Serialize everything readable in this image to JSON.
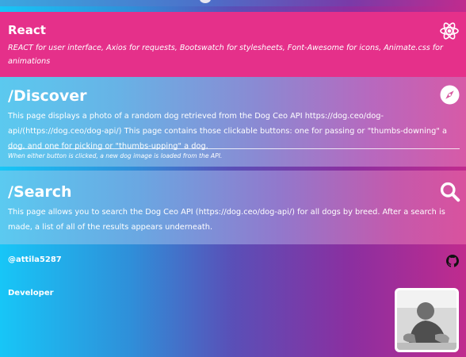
{
  "react": {
    "title": "React",
    "description": "REACT for user interface, Axios for requests, Bootswatch for stylesheets, Font-Awesome for icons, Animate.css for animations",
    "icon": "react-icon"
  },
  "discover": {
    "title": "/Discover",
    "description": "This page displays a photo of a random dog retrieved from the Dog Ceo API https://dog.ceo/dog-api/(https://dog.ceo/dog-api/) This page contains those clickable buttons: one for passing or \"thumbs-downing\" a dog, and one for picking or \"thumbs-upping\" a dog.",
    "note": "When either button is clicked, a new dog image is loaded from the API.",
    "icon": "compass-icon"
  },
  "search": {
    "title": "/Search",
    "description": "This page allows you to search the Dog Ceo API (https://dog.ceo/dog-api/) for all dogs by breed. After a search is made, a list of all of the results appears underneath.",
    "icon": "search-icon"
  },
  "footer": {
    "handle": "@attila5287",
    "role": "Developer",
    "github_icon": "github-icon"
  },
  "colors": {
    "react_card": "#e5308a",
    "accent_pink": "#e62f8b",
    "accent_cyan": "#17c6f7"
  }
}
